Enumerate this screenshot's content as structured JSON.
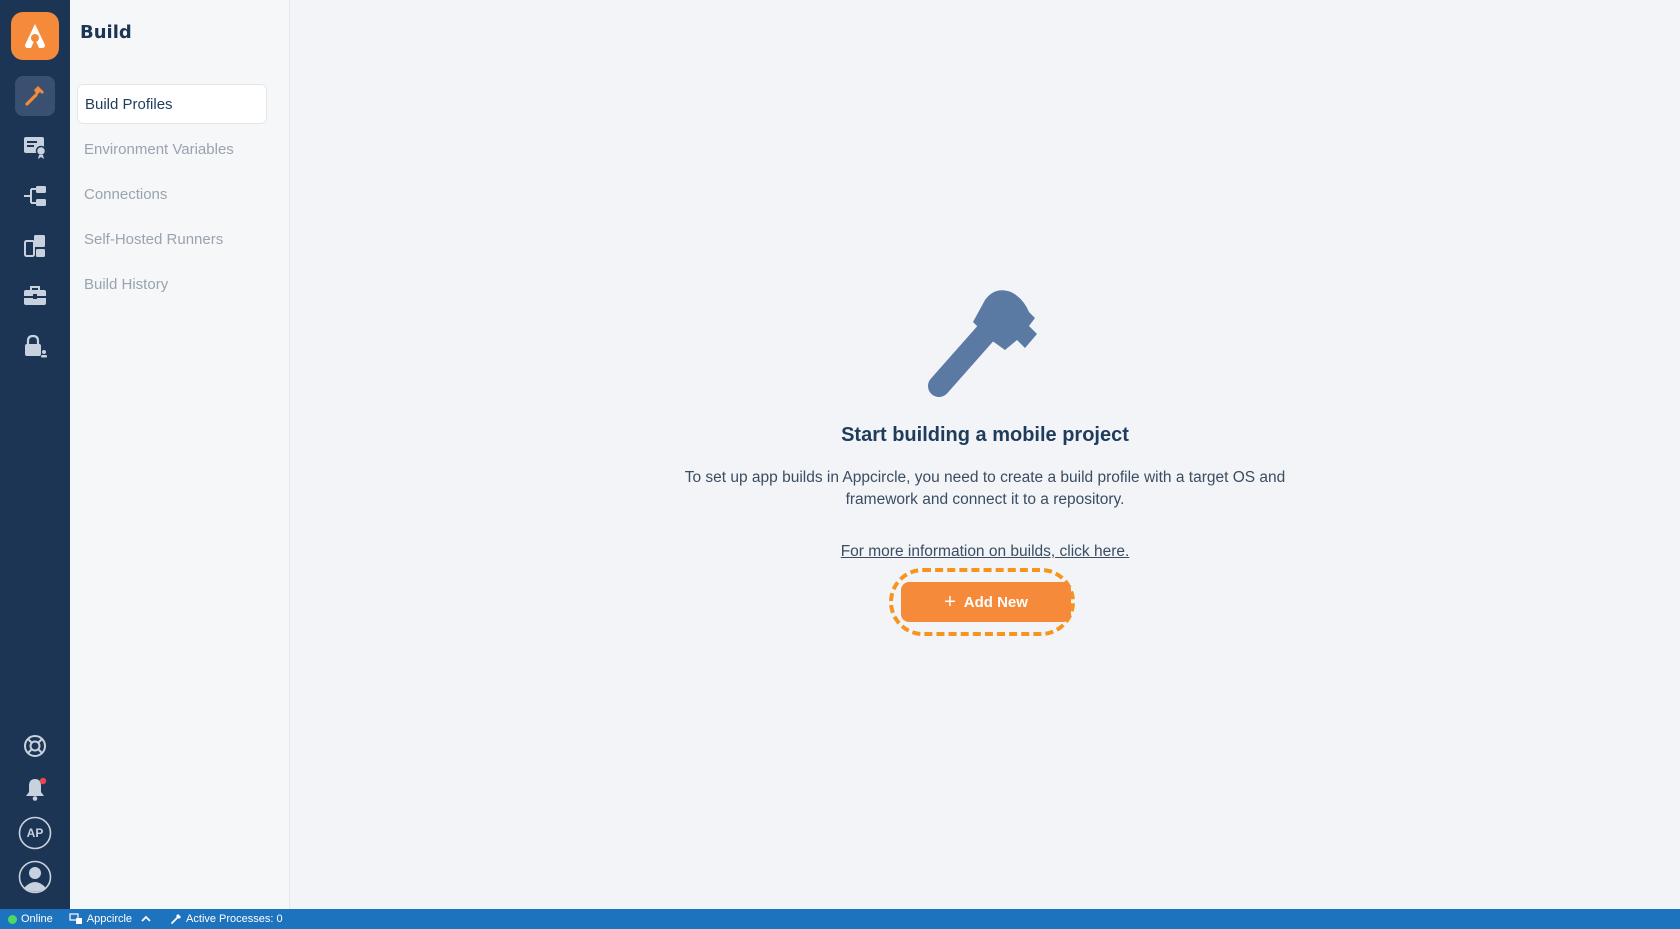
{
  "sidebar": {
    "title": "Build",
    "items": [
      {
        "label": "Build Profiles",
        "active": true
      },
      {
        "label": "Environment Variables",
        "active": false
      },
      {
        "label": "Connections",
        "active": false
      },
      {
        "label": "Self-Hosted Runners",
        "active": false
      },
      {
        "label": "Build History",
        "active": false
      }
    ]
  },
  "rail": {
    "nav_icons": [
      "hammer-icon",
      "certificate-icon",
      "distribute-icon",
      "devices-icon",
      "toolbox-icon",
      "lock-user-icon"
    ],
    "bottom_icons": [
      "help-wheel-icon",
      "bell-icon",
      "organization-avatar",
      "user-avatar-icon"
    ],
    "org_initials": "AP"
  },
  "main": {
    "heading": "Start building a mobile project",
    "description": "To set up app builds in Appcircle, you need to create a build profile with a target OS and framework and connect it to a repository.",
    "link_text": "For more information on builds, click here.",
    "add_button_label": "Add New",
    "add_button_icon": "+"
  },
  "statusbar": {
    "online": "Online",
    "org": "Appcircle",
    "active_processes": "Active Processes: 0"
  },
  "colors": {
    "rail_bg": "#1d3554",
    "accent": "#f58a3a",
    "statusbar_bg": "#1e73be"
  }
}
